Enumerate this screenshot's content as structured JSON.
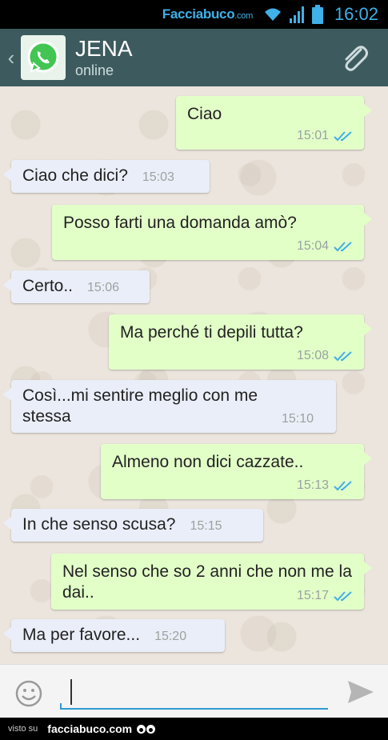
{
  "status_bar": {
    "watermark": "Facciabuco",
    "watermark_suffix": ".com",
    "time": "16:02",
    "icons": [
      "wifi-icon",
      "signal-icon",
      "battery-icon"
    ],
    "color": "#3fb0e8"
  },
  "header": {
    "back_icon": "chevron-left-icon",
    "avatar_icon": "whatsapp-logo-icon",
    "contact_name": "JENA",
    "contact_status": "online",
    "attach_icon": "paperclip-icon",
    "color": "#3d5b5e"
  },
  "messages": [
    {
      "direction": "out",
      "text": "Ciao",
      "time": "15:01",
      "read": true
    },
    {
      "direction": "in",
      "text": "Ciao che dici?",
      "time": "15:03"
    },
    {
      "direction": "out",
      "text": "Posso farti una domanda amò?",
      "time": "15:04",
      "read": true
    },
    {
      "direction": "in",
      "text": "Certo..",
      "time": "15:06"
    },
    {
      "direction": "out",
      "text": "Ma perché ti depili tutta?",
      "time": "15:08",
      "read": true
    },
    {
      "direction": "in",
      "text": "Così...mi sentire meglio con me stessa",
      "time": "15:10"
    },
    {
      "direction": "out",
      "text": "Almeno non dici cazzate..",
      "time": "15:13",
      "read": true
    },
    {
      "direction": "in",
      "text": "In che senso scusa?",
      "time": "15:15"
    },
    {
      "direction": "out",
      "text": "Nel senso che so 2 anni che non me la dai..",
      "time": "15:17",
      "read": true
    },
    {
      "direction": "in",
      "text": "Ma per favore...",
      "time": "15:20"
    }
  ],
  "input_bar": {
    "emoji_icon": "emoji-icon",
    "input_value": "",
    "send_icon": "send-icon"
  },
  "footer": {
    "small_text": "visto su",
    "brand": "facciabuco.com"
  },
  "colors": {
    "outgoing_bubble": "#e2ffc8",
    "incoming_bubble": "#eaeef8",
    "read_ticks": "#3fb0e8"
  }
}
